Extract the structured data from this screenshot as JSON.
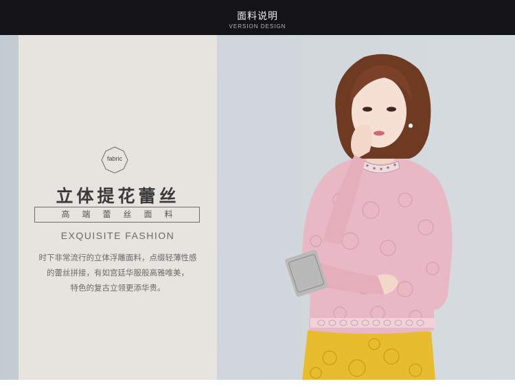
{
  "header": {
    "title": "面料说明",
    "subtitle": "VERSION DESIGN"
  },
  "panel": {
    "badge_text": "fabric",
    "heading": "立体提花蕾丝",
    "boxed_text": "高端蕾丝面料",
    "english_title": "EXQUISITE FASHION",
    "description": [
      "时下非常流行的立体浮雕面料，点缀轻薄性感",
      "的蕾丝拼接，有如宫廷华服般高雅唯美，",
      "特色的复古立领更添华贵。"
    ]
  },
  "colors": {
    "header_bg": "#141418",
    "panel_bg": "#e7e3df",
    "blouse": "#e8b9c4",
    "skirt": "#e7bd2f"
  }
}
